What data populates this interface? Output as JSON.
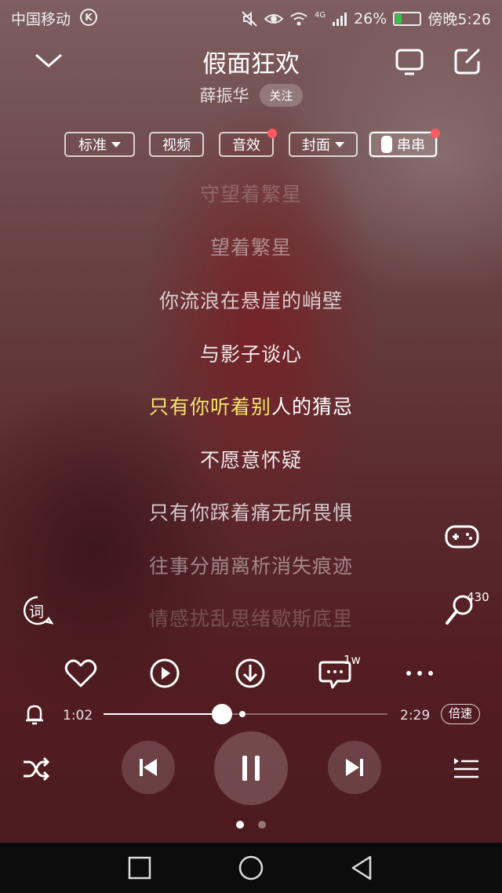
{
  "status_bar": {
    "carrier": "中国移动",
    "k_badge": "K",
    "network": "4G",
    "battery_percent": "26%",
    "battery_level": 0.26,
    "time": "傍晚5:26"
  },
  "header": {
    "title": "假面狂欢",
    "artist": "薛振华",
    "follow_label": "关注"
  },
  "modes": [
    {
      "label": "标准",
      "has_dropdown": true,
      "has_badge": false
    },
    {
      "label": "视频",
      "has_dropdown": false,
      "has_badge": false
    },
    {
      "label": "音效",
      "has_dropdown": false,
      "has_badge": true
    },
    {
      "label": "封面",
      "has_dropdown": true,
      "has_badge": false
    },
    {
      "label": "串串",
      "has_toggle": true,
      "has_badge": true,
      "active": true
    }
  ],
  "lyrics": {
    "line1": "守望着繁星",
    "line2": "望着繁星",
    "line3": "你流浪在悬崖的峭壁",
    "line4": "与影子谈心",
    "current_sung": "只有你听着别",
    "current_rest": "人的猜忌",
    "line6": "不愿意怀疑",
    "line7": "只有你踩着痛无所畏惧",
    "line8": "往事分崩离析消失痕迹",
    "line9": "情感扰乱思绪歇斯底里"
  },
  "side": {
    "lyrics_button_label": "词",
    "karaoke_count": "430"
  },
  "actions": {
    "comment_count": "1w"
  },
  "progress": {
    "current_time": "1:02",
    "total_time": "2:29",
    "played_fraction": 0.416,
    "buffered_fraction": 0.49,
    "speed_label": "倍速"
  },
  "pager": {
    "count": 2,
    "active": 0
  },
  "colors": {
    "lyric_highlight": "#f3e46e",
    "badge_red": "#ff5a5f",
    "battery_green": "#37c24b"
  }
}
